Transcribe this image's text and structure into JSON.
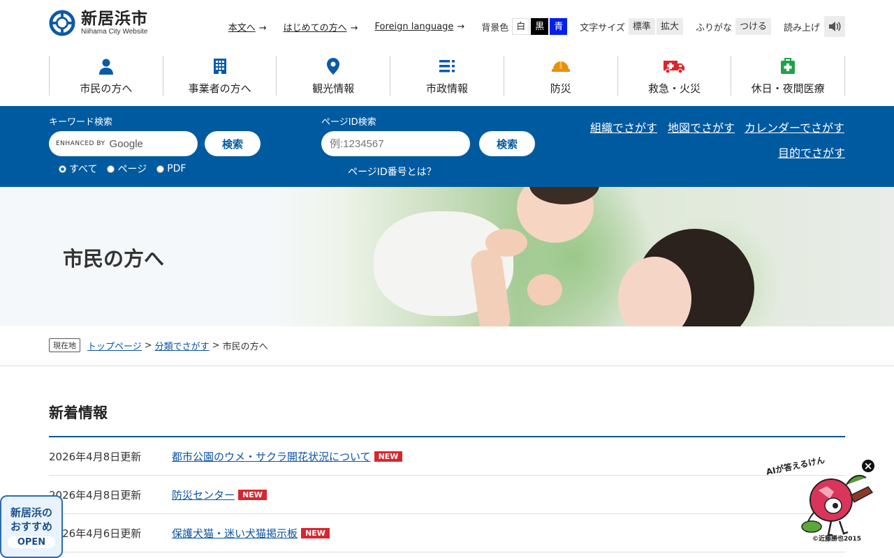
{
  "site": {
    "name": "新居浜市",
    "subtitle": "Niihama City Website"
  },
  "util": {
    "links": [
      "本文へ",
      "はじめての方へ",
      "Foreign language"
    ],
    "bg_label": "背景色",
    "bg_options": [
      "白",
      "黒",
      "青"
    ],
    "font_label": "文字サイズ",
    "font_options": [
      "標準",
      "拡大"
    ],
    "furigana_label": "ふりがな",
    "furigana_action": "つける",
    "read_label": "読み上げ"
  },
  "gnav": [
    {
      "label": "市民の方へ",
      "icon": "person-icon"
    },
    {
      "label": "事業者の方へ",
      "icon": "building-icon"
    },
    {
      "label": "観光情報",
      "icon": "map-pin-icon"
    },
    {
      "label": "市政情報",
      "icon": "list-icon"
    },
    {
      "label": "防災",
      "icon": "helmet-icon"
    },
    {
      "label": "救急・火災",
      "icon": "ambulance-icon"
    },
    {
      "label": "休日・夜間医療",
      "icon": "first-aid-icon"
    }
  ],
  "search": {
    "keyword_label": "キーワード検索",
    "google_enhanced": "ENHANCED BY",
    "google_brand": "Google",
    "button": "検索",
    "radios": [
      "すべて",
      "ページ",
      "PDF"
    ],
    "pageid_label": "ページID検索",
    "pageid_placeholder": "例:1234567",
    "pageid_help": "ページID番号とは？",
    "find_links": [
      "組織でさがす",
      "地図でさがす",
      "カレンダーでさがす",
      "目的でさがす"
    ]
  },
  "hero": {
    "title": "市民の方へ"
  },
  "breadcrumb": {
    "tag": "現在地",
    "items": [
      "トップページ",
      "分類でさがす"
    ],
    "current": "市民の方へ",
    "separator": ">"
  },
  "news": {
    "title": "新着情報",
    "badge": "NEW",
    "items": [
      {
        "date": "2026年4月8日更新",
        "title": "都市公園のウメ・サクラ開花状況について"
      },
      {
        "date": "2026年4月8日更新",
        "title": "防災センター"
      },
      {
        "date": "2026年4月6日更新",
        "title": "保護犬猫・迷い犬猫掲示板"
      }
    ]
  },
  "widgets": {
    "recommend_line1": "新居浜の",
    "recommend_line2": "おすすめ",
    "recommend_open": "OPEN",
    "ai_label": "AIが答えるけん",
    "ai_copyright": "©近藤勝也2015",
    "close_symbol": "×"
  },
  "colors": {
    "primary": "#005aa0",
    "link": "#0a53a3",
    "badge": "#d8262e"
  }
}
